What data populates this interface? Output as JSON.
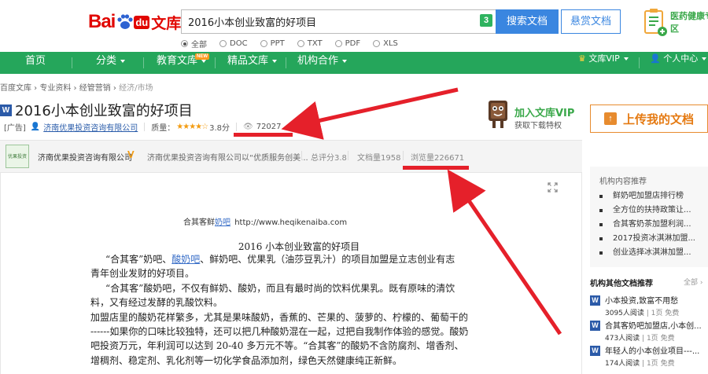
{
  "header": {
    "logo_bai": "Bai",
    "logo_du": "du",
    "logo_wenku": "文库",
    "search_value": "2016小本创业致富的好项目",
    "search_badge": "3",
    "search_button": "搜索文档",
    "reward_button": "悬赏文档",
    "health_text": "医药健康专区",
    "filters": [
      "全部",
      "DOC",
      "PPT",
      "TXT",
      "PDF",
      "XLS"
    ],
    "selected_filter": "全部"
  },
  "nav": {
    "items": [
      "首页",
      "分类",
      "教育文库",
      "精品文库",
      "机构合作"
    ],
    "new_tag": "NEW",
    "vip": "文库VIP",
    "user_center": "个人中心"
  },
  "breadcrumb": [
    "百度文库",
    "专业资料",
    "经管营销",
    "经济/市场"
  ],
  "doc": {
    "type_icon": "W",
    "title": "2016小本创业致富的好项目",
    "ad_tag": "[广告]",
    "publisher": "济南优果投资咨询有限公司",
    "quality_label": "质量：",
    "stars": "★★★★☆",
    "rating": 3.8,
    "rating_text": "3.8分",
    "views": "72027"
  },
  "vip_promo": {
    "title": "加入文库VIP",
    "subtitle": "获取下载特权"
  },
  "upload_button": "上传我的文档",
  "org": {
    "logo_text": "优果投资",
    "name": "济南优果投资咨询有限公司",
    "verified": "V",
    "desc": "济南优果投资咨询有限公司以“优质服务创美...",
    "score": "总评分3.8",
    "docs": "文档量1958",
    "pageviews": "浏览量226671"
  },
  "content": {
    "header_brand": "合其客鲜",
    "header_link": "奶吧",
    "header_url": "http://www.heqikenaiba.com",
    "heading": "2016 小本创业致富的好项目",
    "paragraphs": [
      [
        "“合其客”奶吧、",
        "酸奶吧",
        "、鲜奶吧、优果乳（油莎豆乳汁）的项目加盟是立志创业有志"
      ],
      [
        "青年创业发财的好项目。"
      ],
      [
        "“合其客”酸奶吧，不仅有鲜奶、酸奶，而且有最时尚的饮料优果乳。既有原味的清饮"
      ],
      [
        "料，又有经过发酵的乳酸饮料。"
      ],
      [
        "加盟店里的酸奶花样繁多，尤其是果味酸奶，香蕉的、芒果的、菠萝的、柠檬的、葡萄干的"
      ],
      [
        "------如果你的口味比较独特，还可以把几种酸奶混在一起，过把自我制作体验的感觉。酸奶"
      ],
      [
        "吧投资万元，年利润可以达到 20-40 多万元不等。“合其客”的酸奶不含防腐剂、增香剂、"
      ],
      [
        "增稠剂、稳定剂、乳化剂等一切化学食品添加剂，绿色天然健康纯正新鲜。"
      ]
    ]
  },
  "sidebar": {
    "org_rec_title": "机构内容推荐",
    "org_rec_items": [
      "鲜奶吧加盟店排行榜",
      "全方位的扶持政策让...",
      "合其客奶茶加盟利润...",
      "2017投资冰淇淋加盟...",
      "创业选择冰淇淋加盟..."
    ],
    "other_title": "机构其他文档推荐",
    "more": "全部",
    "docs": [
      {
        "title": "小本投资,致富不用愁",
        "reads": "3095人阅读",
        "pages": "1页",
        "free": "免费"
      },
      {
        "title": "合其客奶吧加盟店,小本创...",
        "reads": "473人阅读",
        "pages": "1页",
        "free": "免费"
      },
      {
        "title": "年轻人的小本创业项目---...",
        "reads": "174人阅读",
        "pages": "1页",
        "free": "免费"
      }
    ]
  },
  "colors": {
    "nav_green": "#25a65b",
    "baidu_red": "#e10601",
    "search_blue": "#3a86e0",
    "annotation_red": "#e5202a",
    "upload_orange": "#e57a12"
  }
}
